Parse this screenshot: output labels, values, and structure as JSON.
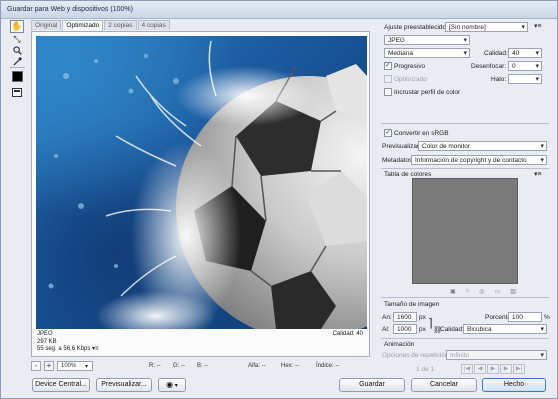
{
  "window": {
    "title": "Guardar para Web y dispositivos (100%)"
  },
  "tools": [
    {
      "name": "hand-tool-icon",
      "glyph": "✋"
    },
    {
      "name": "slice-select-icon",
      "glyph": "⤡"
    },
    {
      "name": "zoom-tool-icon",
      "glyph": "🔍"
    },
    {
      "name": "eyedropper-icon",
      "glyph": "✒"
    },
    {
      "name": "toggle-slices-icon",
      "glyph": "▣"
    }
  ],
  "tabs": [
    "Original",
    "Optimizado",
    "2 copias",
    "4 copias"
  ],
  "preview_info": {
    "format": "JPEG",
    "size": "297 KB",
    "time": "55 seg. a 56,6 Kbps",
    "quality": "Calidad: 40",
    "menu_glyph": "▾≡"
  },
  "status": {
    "zoom": "100%",
    "r": "R: --",
    "g": "G: --",
    "b": "B: --",
    "alpha": "Alfa: --",
    "hex": "Hex: --",
    "index": "Índice: --"
  },
  "buttons": {
    "device_central": "Device Central...",
    "preview": "Previsualizar...",
    "save": "Guardar",
    "cancel": "Cancelar",
    "done": "Hecho"
  },
  "settings": {
    "preset_label": "Ajuste preestablecido:",
    "preset_value": "[Sin nombre]",
    "format": "JPEG",
    "quality_level": "Mediana",
    "quality_label": "Calidad:",
    "quality_value": "40",
    "progressive_label": "Progresivo",
    "blur_label": "Desenfocar:",
    "blur_value": "0",
    "optimized_label": "Optimizado",
    "halo_label": "Halo:",
    "halo_value": "",
    "embed_profile_label": "Incrustar perfil de color",
    "convert_srgb_label": "Convertir en sRGB",
    "preview_label": "Previsualizar:",
    "preview_value": "Color de monitor",
    "metadata_label": "Metadatos:",
    "metadata_value": "Información de copyright y de contacto"
  },
  "color_table": {
    "title": "Tabla de colores"
  },
  "image_size": {
    "title": "Tamaño de imagen",
    "w_label": "An:",
    "w_value": "1600",
    "h_label": "Al:",
    "h_value": "1000",
    "unit": "px",
    "percent_label": "Porcentaje:",
    "percent_value": "100",
    "percent_unit": "%",
    "quality_label": "Calidad:",
    "quality_value": "Bicúbica"
  },
  "animation": {
    "title": "Animación",
    "loop_label": "Opciones de repetición:",
    "loop_value": "Infinito",
    "frame_counter": "1 de 1"
  },
  "colors": {
    "accent": "#3f78c4",
    "color_table_bg": "#7b7b7b"
  }
}
